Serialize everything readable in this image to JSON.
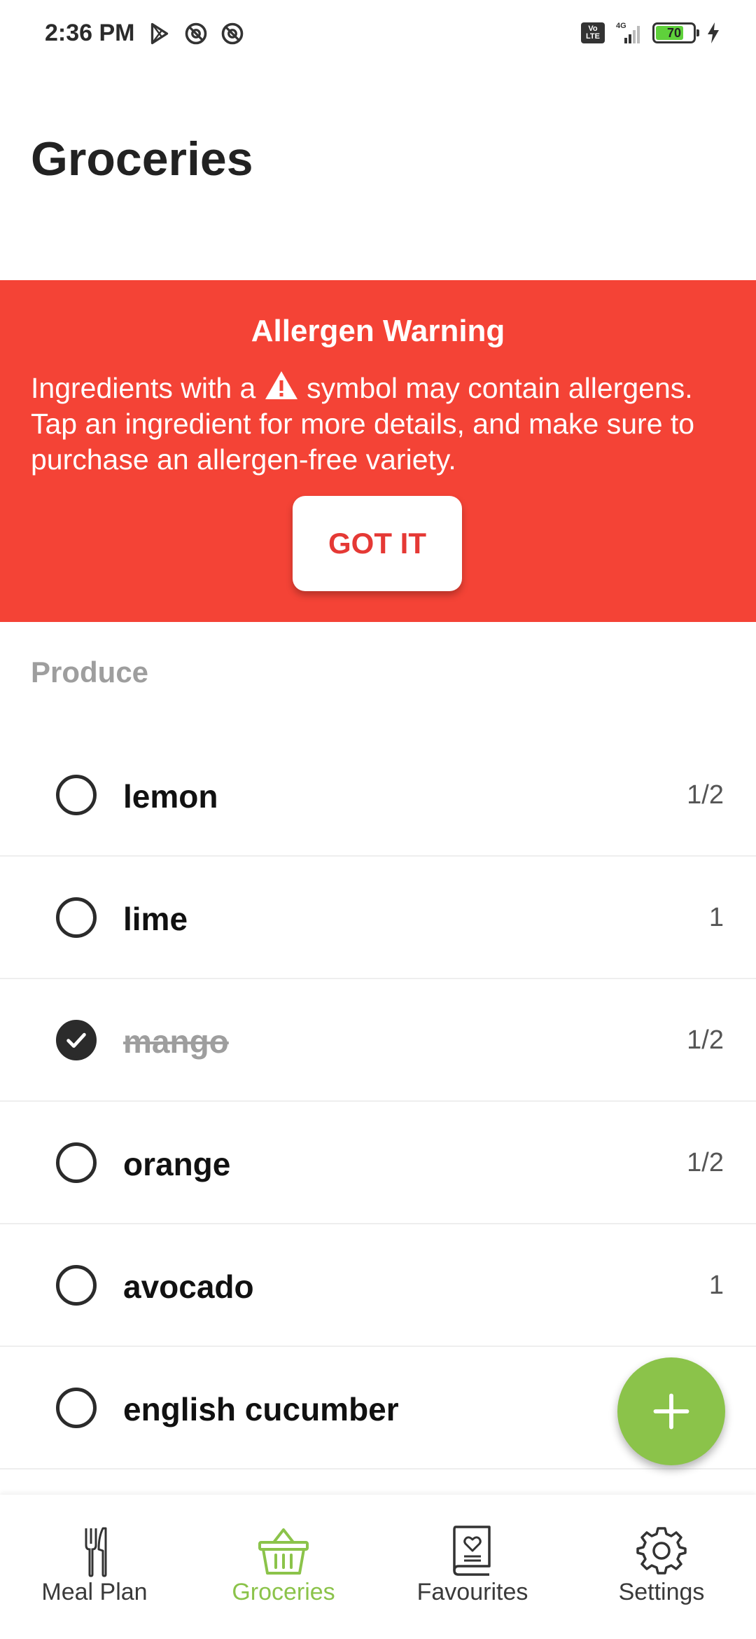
{
  "status_bar": {
    "time": "2:36 PM",
    "network": "4G",
    "volte": [
      "Vo",
      "LTE"
    ],
    "battery_level": "70"
  },
  "header": {
    "title": "Groceries"
  },
  "allergen_banner": {
    "title": "Allergen Warning",
    "text_before_icon": "Ingredients with a",
    "text_after_icon": "symbol may contain allergens. Tap an ingredient for more details, and make sure to purchase an allergen-free variety.",
    "icon": "warning-triangle-icon",
    "button_label": "GOT IT",
    "color": "#f44336"
  },
  "section": {
    "title": "Produce"
  },
  "items": [
    {
      "name": "lemon",
      "qty": "1/2",
      "checked": false
    },
    {
      "name": "lime",
      "qty": "1",
      "checked": false
    },
    {
      "name": "mango",
      "qty": "1/2",
      "checked": true
    },
    {
      "name": "orange",
      "qty": "1/2",
      "checked": false
    },
    {
      "name": "avocado",
      "qty": "1",
      "checked": false
    },
    {
      "name": "english cucumber",
      "qty": "",
      "checked": false
    }
  ],
  "fab": {
    "icon": "plus-icon",
    "color": "#8bc34a"
  },
  "bottom_nav": {
    "items": [
      {
        "label": "Meal Plan",
        "icon": "fork-knife-icon",
        "active": false
      },
      {
        "label": "Groceries",
        "icon": "basket-icon",
        "active": true
      },
      {
        "label": "Favourites",
        "icon": "heart-book-icon",
        "active": false
      },
      {
        "label": "Settings",
        "icon": "gear-icon",
        "active": false
      }
    ],
    "active_color": "#8bc34a"
  }
}
